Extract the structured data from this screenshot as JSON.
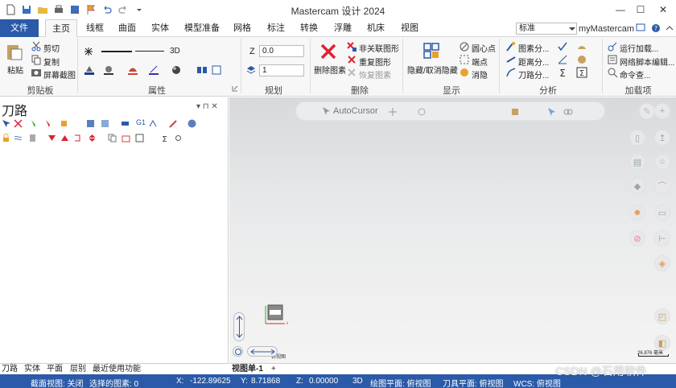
{
  "window": {
    "title": "Mastercam 设计 2024",
    "minimize_glyph": "—",
    "maximize_glyph": "☐",
    "close_glyph": "✕"
  },
  "ribbon_tabs": [
    {
      "label": "文件"
    },
    {
      "label": "主页"
    },
    {
      "label": "线框"
    },
    {
      "label": "曲面"
    },
    {
      "label": "实体"
    },
    {
      "label": "模型准备"
    },
    {
      "label": "网格"
    },
    {
      "label": "标注"
    },
    {
      "label": "转换"
    },
    {
      "label": "浮雕"
    },
    {
      "label": "机床"
    },
    {
      "label": "视图"
    }
  ],
  "style_dropdown": {
    "value": "标准"
  },
  "user": {
    "label": "myMastercam"
  },
  "clipboard": {
    "paste": "粘贴",
    "cut": "剪切",
    "copy": "复制",
    "screenshot": "屏幕截图",
    "group": "剪贴板"
  },
  "attributes": {
    "mode_3d": "3D",
    "group": "属性"
  },
  "planning": {
    "z_label": "Z",
    "z_value": "0.0",
    "level_value": "1",
    "group": "规划"
  },
  "delete": {
    "delete_entity": "删除图素",
    "delete_unrelated": "非关联图形",
    "repeat_shape": "重复图形",
    "restore_entity": "恢复图素",
    "group": "删除"
  },
  "display": {
    "hide_show": "隐藏/取消隐藏",
    "center_point": "圆心点",
    "endpoint": "端点",
    "blank": "消隐",
    "group": "显示"
  },
  "analysis": {
    "entity_analyze": "图素分...",
    "distance_analyze": "距离分...",
    "toolpath_analyze": "刀路分...",
    "group": "分析"
  },
  "addins": {
    "run_addin": "运行加载...",
    "net_script": "网络脚本编辑...",
    "command_find": "命令查...",
    "group": "加载项"
  },
  "toolpath_panel": {
    "title": "刀路",
    "pin": "▾  ⊓  ✕"
  },
  "left_tabs": [
    {
      "label": "刀路"
    },
    {
      "label": "实体"
    },
    {
      "label": "平面"
    },
    {
      "label": "层别"
    },
    {
      "label": "最近使用功能"
    }
  ],
  "viewport": {
    "autocursor": "AutoCursor",
    "gnomen_label": "俯视图",
    "scale_label": "26.876 毫米"
  },
  "view_tabs": {
    "active": "视图单-1",
    "add": "+"
  },
  "status": {
    "section_view": "截面视图: 关闭",
    "selected": "选择的图素: 0",
    "x_label": "X:",
    "x_value": "-122.89625",
    "y_label": "Y:",
    "y_value": "8.71868",
    "z_label": "Z:",
    "z_value": "0.00000",
    "mode": "3D",
    "drawing_plane": "绘图平面: 俯视图",
    "tool_plane": "刀具平面: 俯视图",
    "wcs": "WCS: 俯视图"
  },
  "watermark": "CSDN @石用软件"
}
